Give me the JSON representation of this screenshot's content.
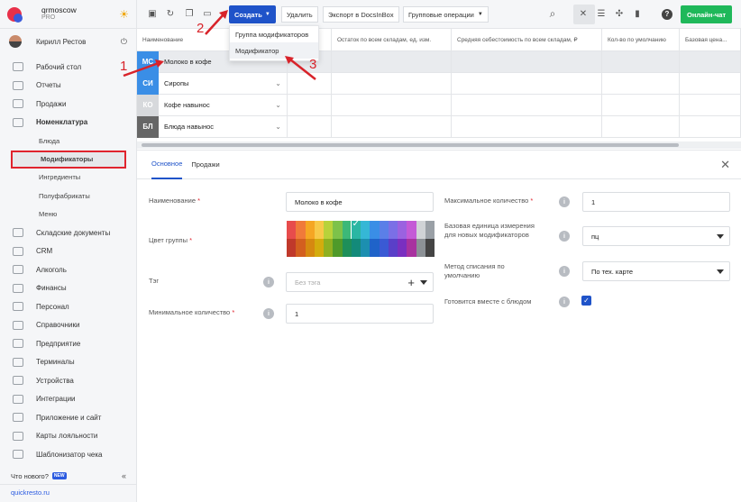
{
  "brand": {
    "name": "qrmoscow",
    "plan": "PRO"
  },
  "user": {
    "name": "Кирилл Рестов"
  },
  "sidebar": {
    "items": [
      {
        "label": "Рабочий стол"
      },
      {
        "label": "Отчеты"
      },
      {
        "label": "Продажи"
      },
      {
        "label": "Номенклатура"
      },
      {
        "label": "Блюда"
      },
      {
        "label": "Модификаторы"
      },
      {
        "label": "Ингредиенты"
      },
      {
        "label": "Полуфабрикаты"
      },
      {
        "label": "Меню"
      },
      {
        "label": "Складские документы"
      },
      {
        "label": "CRM"
      },
      {
        "label": "Алкоголь"
      },
      {
        "label": "Финансы"
      },
      {
        "label": "Персонал"
      },
      {
        "label": "Справочники"
      },
      {
        "label": "Предприятие"
      },
      {
        "label": "Терминалы"
      },
      {
        "label": "Устройства"
      },
      {
        "label": "Интеграции"
      },
      {
        "label": "Приложение и сайт"
      },
      {
        "label": "Карты лояльности"
      },
      {
        "label": "Шаблонизатор чека"
      }
    ],
    "whats_new": "Что нового?",
    "new_badge": "NEW",
    "site_link": "quickresto.ru"
  },
  "toolbar": {
    "create_label": "Создать",
    "delete_label": "Удалить",
    "export_label": "Экспорт в DocsInBox",
    "group_ops_label": "Групповые операции",
    "online_chat_label": "Онлайн-чат"
  },
  "dropdown": {
    "items": [
      {
        "label": "Группа модификаторов"
      },
      {
        "label": "Модификатор"
      }
    ]
  },
  "table": {
    "columns": [
      "Наименование",
      "",
      "Остаток по всем складам, ед. изм.",
      "Средняя себестоимость по всем складам, ₽",
      "Кол-во по умолчанию",
      "Базовая цена..."
    ],
    "rows": [
      {
        "tile": "МС",
        "name": "Молоко в кофе",
        "color": "#3a8ee6"
      },
      {
        "tile": "СИ",
        "name": "Сиропы",
        "color": "#3a8ee6"
      },
      {
        "tile": "КО",
        "name": "Кофе навынос",
        "color": "#d7d9dc"
      },
      {
        "tile": "БЛ",
        "name": "Блюда навынос",
        "color": "#666666"
      }
    ]
  },
  "form": {
    "tabs": [
      {
        "label": "Основное"
      },
      {
        "label": "Продажи"
      }
    ],
    "name_label": "Наименование",
    "name_value": "Молоко в кофе",
    "color_label": "Цвет группы",
    "tag_label": "Тэг",
    "tag_placeholder": "Без тэга",
    "min_qty_label": "Минимальное количество",
    "min_qty_value": "1",
    "max_qty_label": "Максимальное количество",
    "max_qty_value": "1",
    "base_unit_label": "Базовая единица измерения для новых модификаторов",
    "base_unit_value": "пц",
    "writeoff_label": "Метод списания по умолчанию",
    "writeoff_value": "По тех. карте",
    "cook_with_label": "Готовится вместе с блюдом",
    "required_mark": "*"
  },
  "annotations": {
    "one": "1",
    "two": "2",
    "three": "3"
  },
  "colors": {
    "accent": "#1f53c9",
    "online": "#1fb85a",
    "annotation": "#d8232a",
    "palette_top": [
      "#e74c4c",
      "#f07a3a",
      "#f5a623",
      "#f7c948",
      "#b8d23a",
      "#7dc24a",
      "#3cb878",
      "#2bb6a3",
      "#35b7d6",
      "#3a8ee6",
      "#5b7fe8",
      "#7b6fe6",
      "#9b62e0",
      "#c45ad6",
      "#d0d3d6",
      "#9aa0a6"
    ],
    "palette_bottom": [
      "#c0392b",
      "#d35f1f",
      "#d68910",
      "#d4ac0d",
      "#8fb021",
      "#4f9a2a",
      "#1e8f5a",
      "#138a7a",
      "#1c8fb0",
      "#1f63c9",
      "#3a5ad4",
      "#5a3fc8",
      "#7a2fc0",
      "#a8329f",
      "#8c9196",
      "#444444"
    ],
    "selected_swatch": "#2bb6a3"
  }
}
